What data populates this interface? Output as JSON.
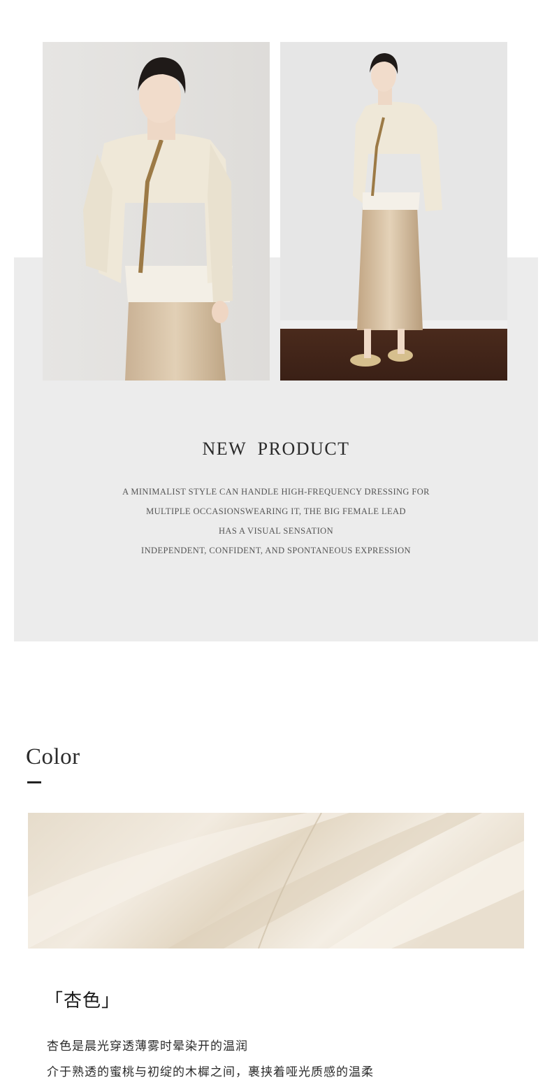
{
  "new_product": {
    "title": "NEW PRODUCT",
    "lines": [
      "A MINIMALIST STYLE CAN HANDLE HIGH-FREQUENCY DRESSING FOR",
      "MULTIPLE OCCASIONSWEARING IT, THE BIG FEMALE LEAD",
      "HAS A VISUAL SENSATION",
      "INDEPENDENT, CONFIDENT, AND SPONTANEOUS EXPRESSION"
    ]
  },
  "color_section": {
    "title": "Color",
    "color_name": "「杏色」",
    "description": [
      "杏色是晨光穿透薄雾时晕染开的温润",
      "介于熟透的蜜桃与初绽的木樨之间，裹挟着哑光质感的温柔"
    ]
  },
  "colors": {
    "panel": "#ececec",
    "jacket": "#efe8d8",
    "skirt": "#cdb596",
    "fabric": "#ede4d6"
  }
}
